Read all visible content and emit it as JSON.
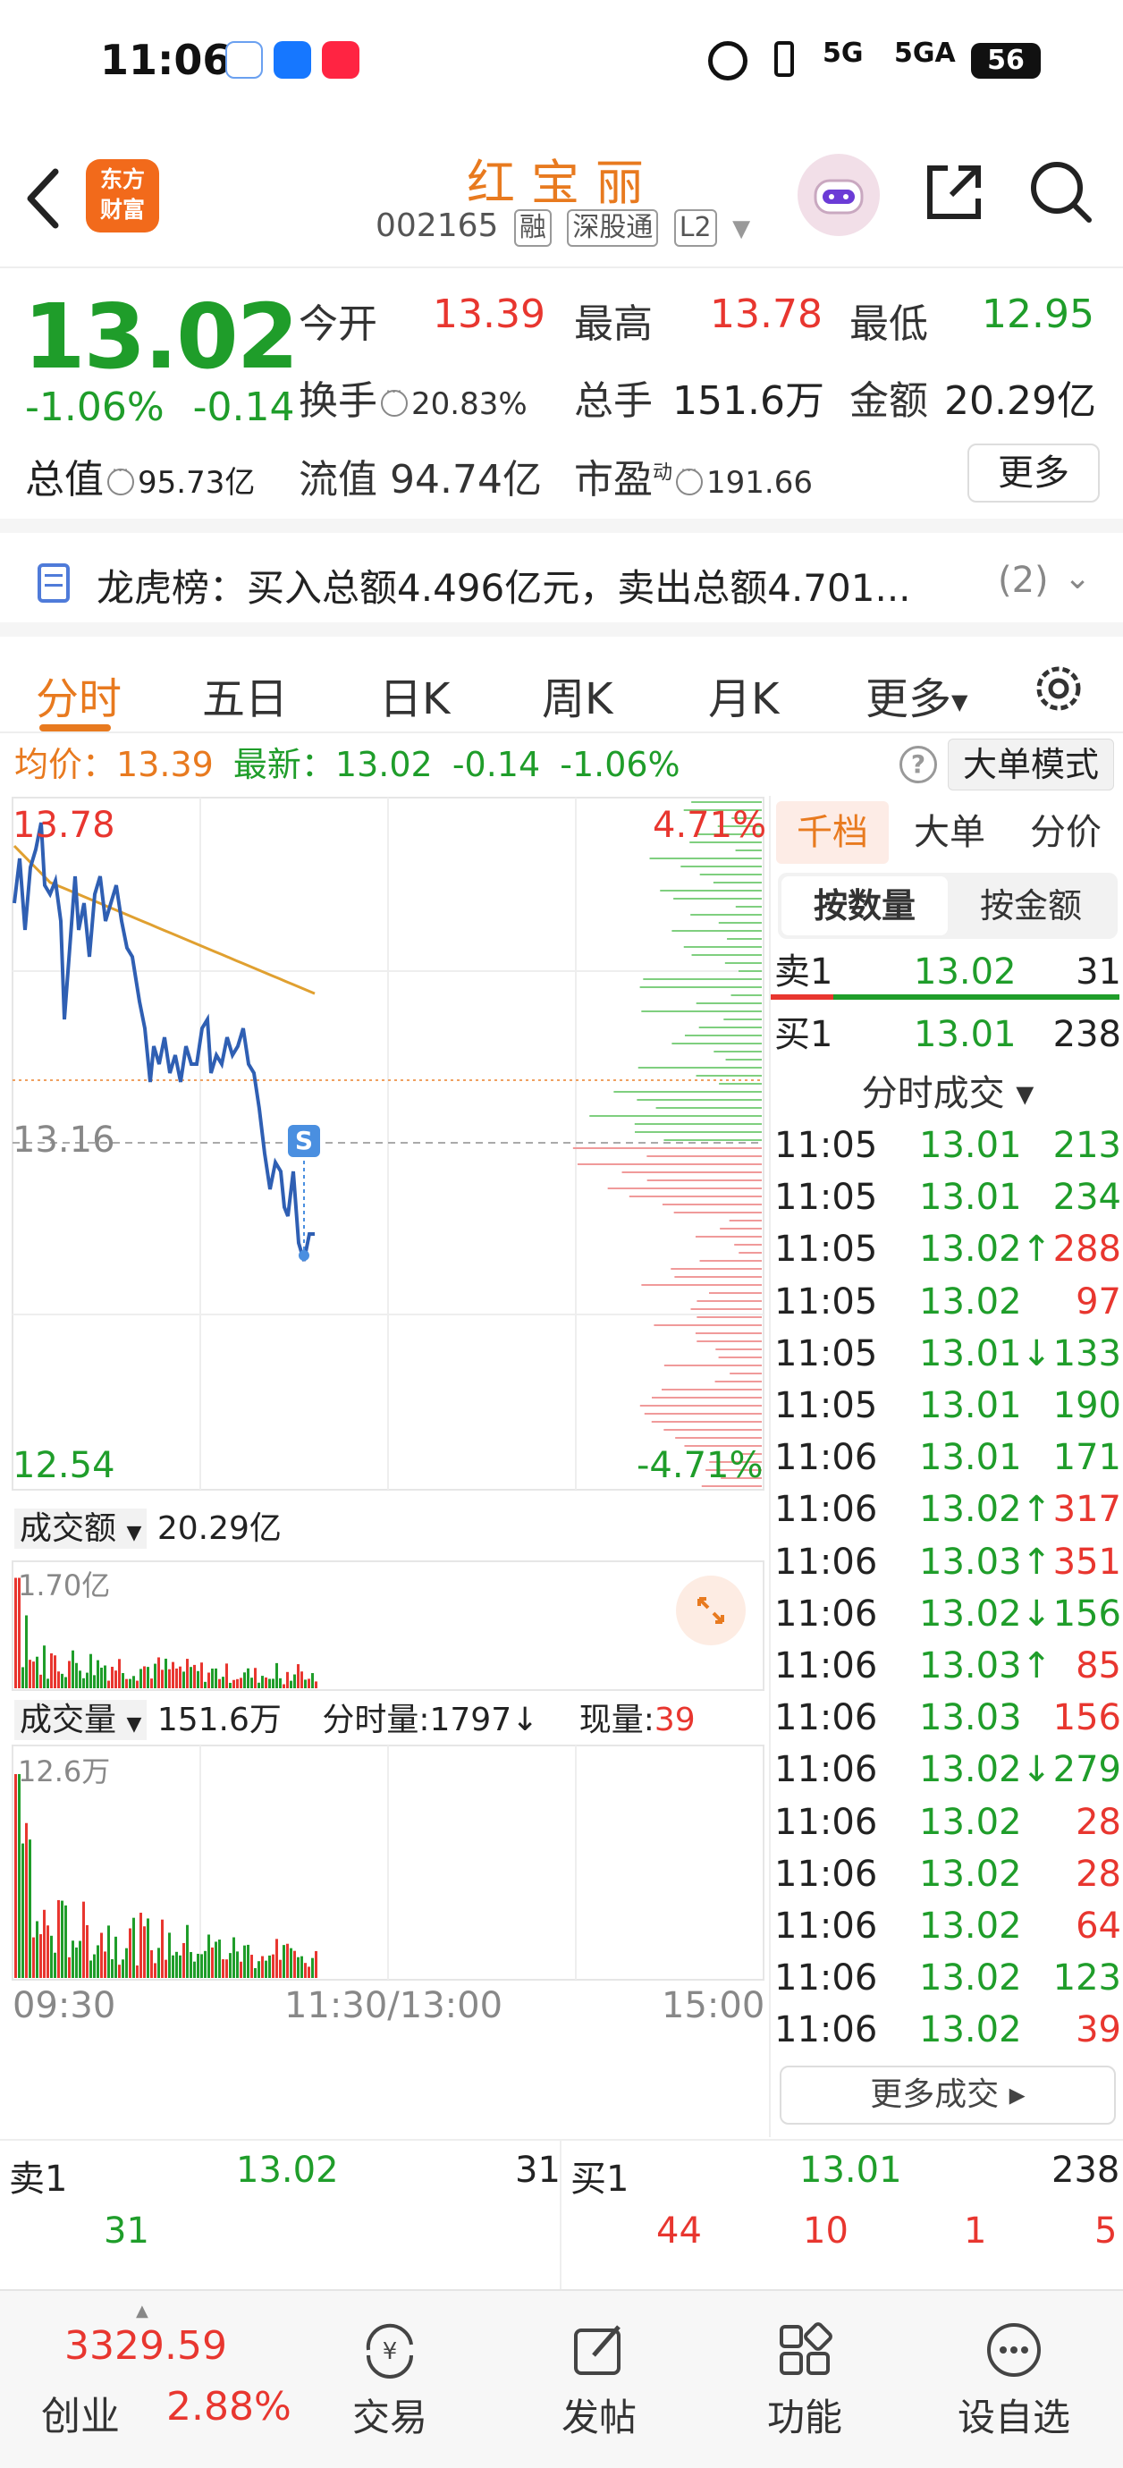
{
  "status_bar": {
    "time": "11:06",
    "app_icons": [
      "weather-app-icon",
      "alipay-icon",
      "xiaohongshu-icon"
    ],
    "network": "5G",
    "network2": "5GA",
    "battery": "56"
  },
  "header": {
    "logo_line1": "东方",
    "logo_line2": "财富",
    "stock_name": "红宝丽",
    "stock_code": "002165",
    "tags": [
      "融",
      "深股通",
      "L2"
    ]
  },
  "quote": {
    "price": "13.02",
    "change_pct": "-1.06%",
    "change_abs": "-0.14",
    "open_label": "今开",
    "open_value": "13.39",
    "high_label": "最高",
    "high_value": "13.78",
    "low_label": "最低",
    "low_value": "12.95",
    "turnover_label": "换手",
    "turnover_value": "20.83%",
    "volume_label": "总手",
    "volume_value": "151.6万",
    "amount_label": "金额",
    "amount_value": "20.29亿",
    "mktcap_label": "总值",
    "mktcap_value": "95.73亿",
    "float_label": "流值",
    "float_value": "94.74亿",
    "pe_label": "市盈",
    "pe_sup": "动",
    "pe_value": "191.66",
    "more_label": "更多"
  },
  "dragon": {
    "text": "龙虎榜：买入总额4.496亿元，卖出总额4.701...",
    "count": "(2)"
  },
  "tabs": [
    "分时",
    "五日",
    "日K",
    "周K",
    "月K",
    "更多"
  ],
  "chart_info": {
    "avg_label": "均价：",
    "avg_value": "13.39",
    "latest_label": "最新：",
    "latest_value": "13.02",
    "latest_change": "-0.14",
    "latest_pct": "-1.06%",
    "big_order_mode": "大单模式"
  },
  "price_chart": {
    "top_price": "13.78",
    "top_pct": "4.71%",
    "mid_price": "13.16",
    "marker": "S",
    "bottom_price": "12.54",
    "bottom_pct": "-4.71%"
  },
  "amount_chart": {
    "selector": "成交额",
    "total": "20.29亿",
    "max_label": "1.70亿"
  },
  "volume_chart": {
    "selector": "成交量",
    "total": "151.6万",
    "tick_vol_label": "分时量:",
    "tick_vol_value": "1797↓",
    "cur_vol_label": "现量:",
    "cur_vol_value": "39",
    "max_label": "12.6万"
  },
  "time_axis": [
    "09:30",
    "11:30/13:00",
    "15:00"
  ],
  "right_panel": {
    "tabs": [
      "千档",
      "大单",
      "分价"
    ],
    "toggle": [
      "按数量",
      "按金额"
    ],
    "ask1": {
      "label": "卖1",
      "price": "13.02",
      "vol": "31"
    },
    "bid1": {
      "label": "买1",
      "price": "13.01",
      "vol": "238"
    },
    "ticks_title": "分时成交 ▾",
    "ticks": [
      {
        "t": "11:05",
        "p": "13.01",
        "v": "213",
        "pc": "green",
        "vc": "green"
      },
      {
        "t": "11:05",
        "p": "13.01",
        "v": "234",
        "pc": "green",
        "vc": "green"
      },
      {
        "t": "11:05",
        "p": "13.02↑",
        "v": "288",
        "pc": "green",
        "vc": "red"
      },
      {
        "t": "11:05",
        "p": "13.02",
        "v": "97",
        "pc": "green",
        "vc": "red"
      },
      {
        "t": "11:05",
        "p": "13.01↓",
        "v": "133",
        "pc": "green",
        "vc": "green"
      },
      {
        "t": "11:05",
        "p": "13.01",
        "v": "190",
        "pc": "green",
        "vc": "green"
      },
      {
        "t": "11:06",
        "p": "13.01",
        "v": "171",
        "pc": "green",
        "vc": "green"
      },
      {
        "t": "11:06",
        "p": "13.02↑",
        "v": "317",
        "pc": "green",
        "vc": "red"
      },
      {
        "t": "11:06",
        "p": "13.03↑",
        "v": "351",
        "pc": "green",
        "vc": "red"
      },
      {
        "t": "11:06",
        "p": "13.02↓",
        "v": "156",
        "pc": "green",
        "vc": "green"
      },
      {
        "t": "11:06",
        "p": "13.03↑",
        "v": "85",
        "pc": "green",
        "vc": "red"
      },
      {
        "t": "11:06",
        "p": "13.03",
        "v": "156",
        "pc": "green",
        "vc": "red"
      },
      {
        "t": "11:06",
        "p": "13.02↓",
        "v": "279",
        "pc": "green",
        "vc": "green"
      },
      {
        "t": "11:06",
        "p": "13.02",
        "v": "28",
        "pc": "green",
        "vc": "red"
      },
      {
        "t": "11:06",
        "p": "13.02",
        "v": "28",
        "pc": "green",
        "vc": "red"
      },
      {
        "t": "11:06",
        "p": "13.02",
        "v": "64",
        "pc": "green",
        "vc": "red"
      },
      {
        "t": "11:06",
        "p": "13.02",
        "v": "123",
        "pc": "green",
        "vc": "green"
      },
      {
        "t": "11:06",
        "p": "13.02",
        "v": "39",
        "pc": "green",
        "vc": "red"
      }
    ],
    "more_ticks": "更多成交 ▸"
  },
  "bottom_book": {
    "ask_label": "卖1",
    "ask_price": "13.02",
    "ask_vol": "31",
    "bid_label": "买1",
    "bid_price": "13.01",
    "bid_vol": "238",
    "ask_queue": [
      "31"
    ],
    "bid_queue": [
      "44",
      "10",
      "1",
      "5"
    ]
  },
  "bottom_nav": {
    "index_value": "3329.59",
    "index_name": "创业",
    "index_pct": "2.88%",
    "items": [
      "交易",
      "发帖",
      "功能",
      "设自选"
    ]
  },
  "colors": {
    "up": "#e8362f",
    "down": "#1f9d2a",
    "accent": "#e87a1f",
    "price_line": "#2f5fb3",
    "avg_line": "#e0a030"
  }
}
